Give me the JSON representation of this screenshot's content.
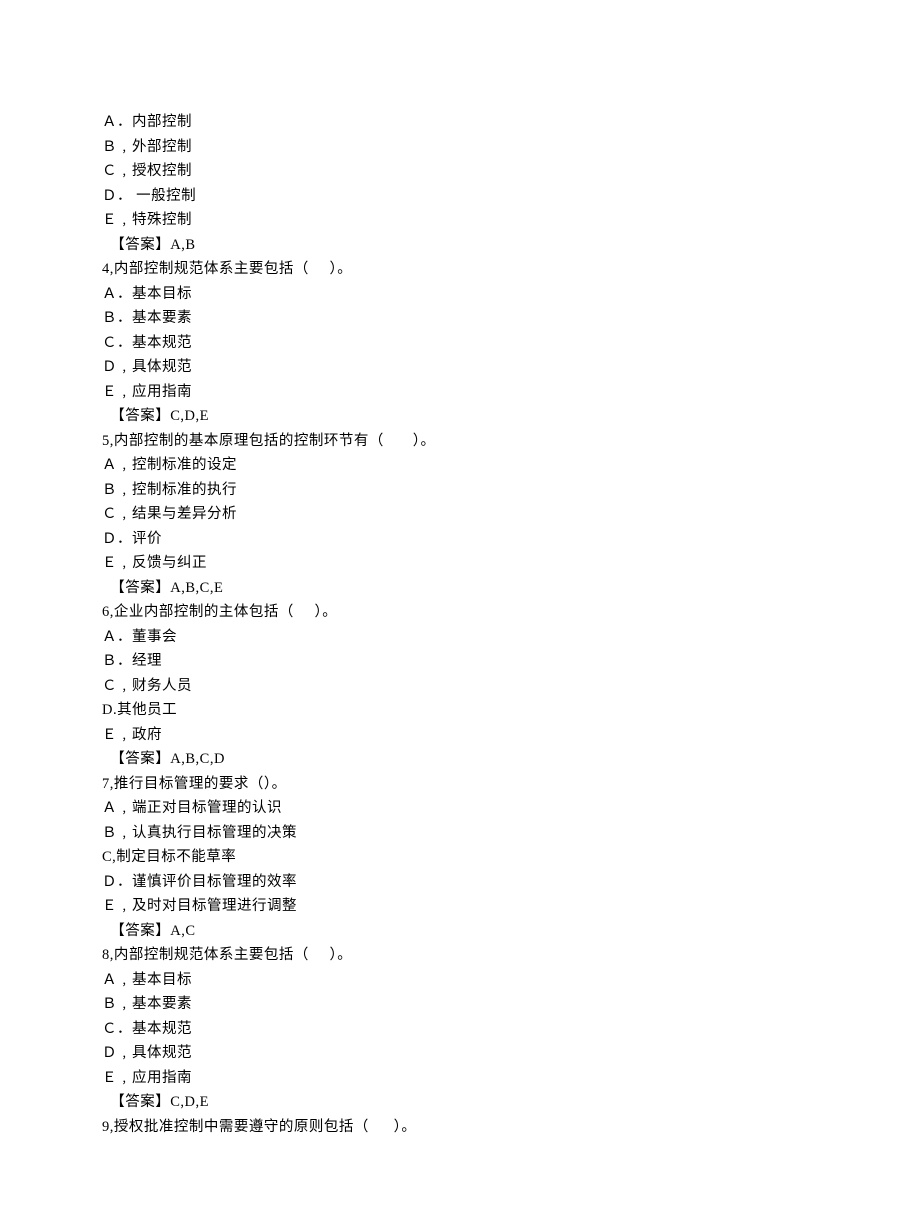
{
  "lines": [
    "Ａ．内部控制",
    "Ｂ﹐外部控制",
    "Ｃ﹐授权控制",
    "Ｄ． 一般控制",
    "Ｅ﹐特殊控制",
    "  【答案】A,B",
    "4,内部控制规范体系主要包括（     ）。",
    "Ａ．基本目标",
    "Ｂ．基本要素",
    "Ｃ．基本规范",
    "Ｄ﹐具体规范",
    "Ｅ﹐应用指南",
    "  【答案】C,D,E",
    "5,内部控制的基本原理包括的控制环节有（       ）。",
    "Ａ﹐控制标准的设定",
    "Ｂ﹐控制标准的执行",
    "Ｃ﹐结果与差异分析",
    "Ｄ．评价",
    "Ｅ﹐反馈与纠正",
    "  【答案】A,B,C,E",
    "6,企业内部控制的主体包括（     ）。",
    "Ａ．董事会",
    "Ｂ．经理",
    "Ｃ﹐财务人员",
    "D.其他员工",
    "Ｅ﹐政府",
    "  【答案】A,B,C,D",
    "7,推行目标管理的要求（）。",
    "Ａ﹐端正对目标管理的认识",
    "Ｂ﹐认真执行目标管理的决策",
    "C,制定目标不能草率",
    "Ｄ．谨慎评价目标管理的效率",
    "Ｅ﹐及时对目标管理进行调整",
    "  【答案】A,C",
    "8,内部控制规范体系主要包括（     ）。",
    "Ａ﹐基本目标",
    "Ｂ﹐基本要素",
    "Ｃ．基本规范",
    "Ｄ﹐具体规范",
    "Ｅ﹐应用指南",
    "  【答案】C,D,E",
    "9,授权批准控制中需要遵守的原则包括（      ）。"
  ]
}
